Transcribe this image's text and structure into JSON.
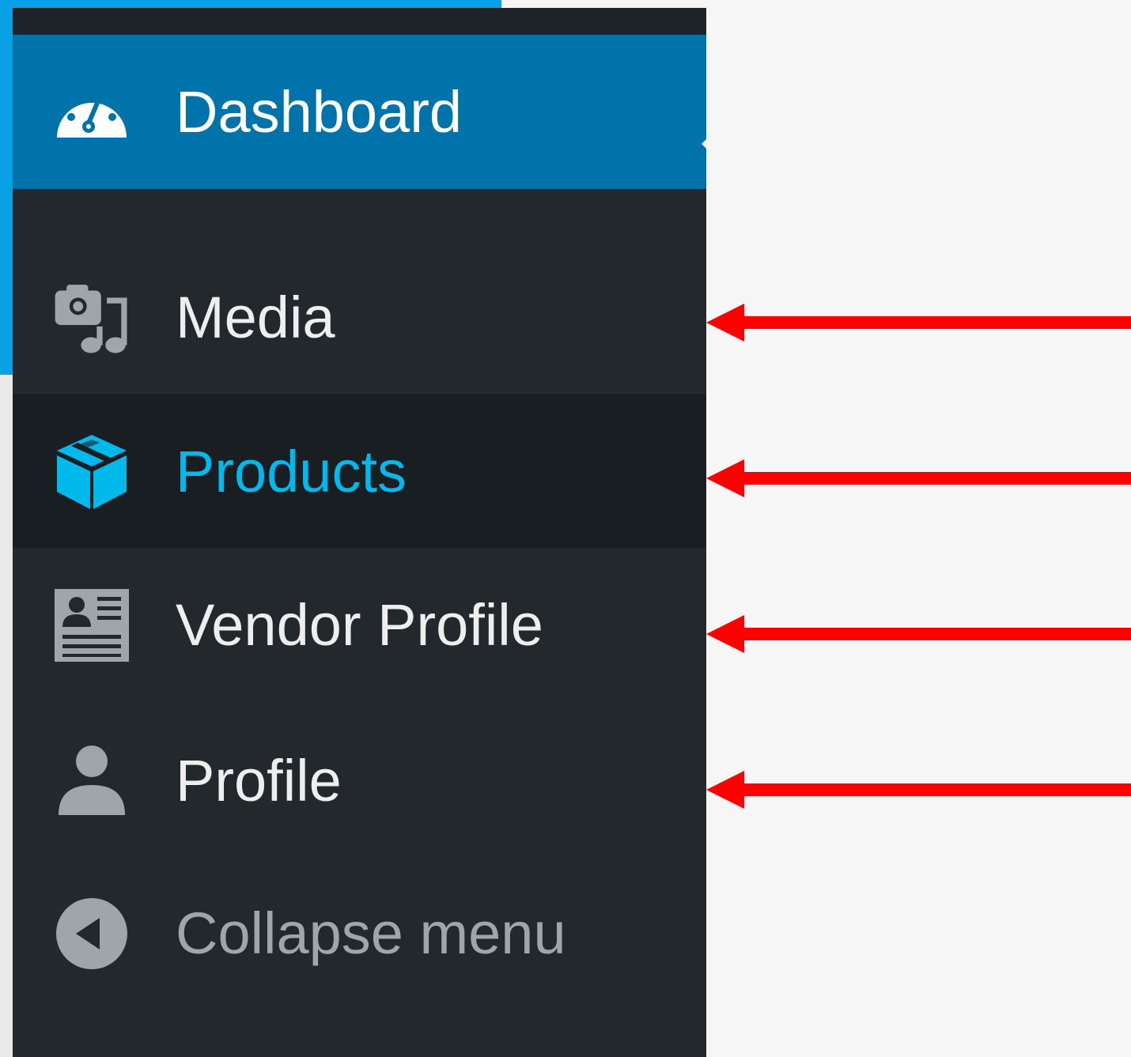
{
  "sidebar": {
    "items": [
      {
        "key": "dashboard",
        "label": "Dashboard",
        "icon": "dashboard-gauge-icon",
        "state": "current"
      },
      {
        "key": "media",
        "label": "Media",
        "icon": "media-camera-music-icon",
        "state": "normal"
      },
      {
        "key": "products",
        "label": "Products",
        "icon": "products-box-icon",
        "state": "hover"
      },
      {
        "key": "vendor_profile",
        "label": "Vendor Profile",
        "icon": "vendor-id-card-icon",
        "state": "normal"
      },
      {
        "key": "profile",
        "label": "Profile",
        "icon": "user-icon",
        "state": "normal"
      }
    ],
    "collapse": {
      "label": "Collapse menu",
      "icon": "collapse-arrow-icon"
    }
  },
  "annotations": {
    "arrow_color": "#ff0000",
    "arrows_point_to": [
      "Media",
      "Products",
      "Vendor Profile",
      "Profile"
    ]
  },
  "colors": {
    "sidebar_bg": "#23282d",
    "current_bg": "#0073aa",
    "hover_bg": "#191e23",
    "hover_text": "#00b9eb",
    "page_accent": "#0aa0e6"
  }
}
